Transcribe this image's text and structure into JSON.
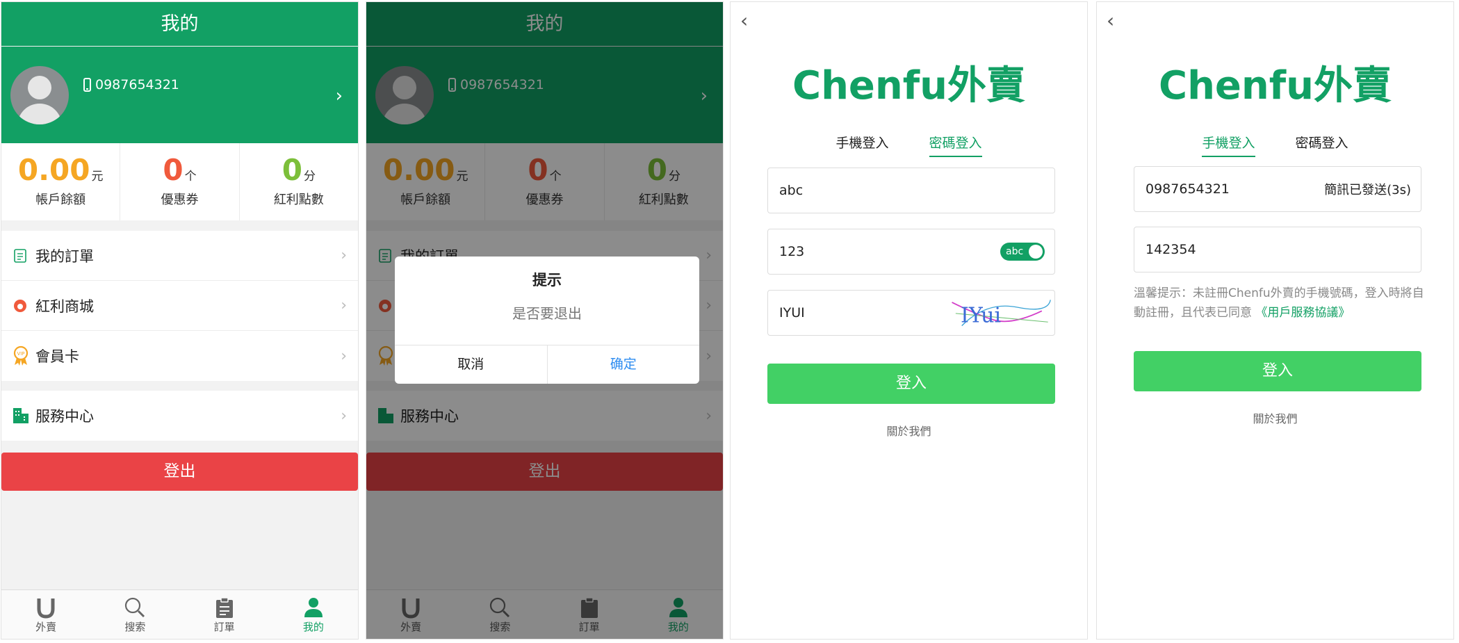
{
  "profile_screen": {
    "title": "我的",
    "phone": "0987654321",
    "stats": [
      {
        "value": "0.00",
        "unit": "元",
        "label": "帳戶餘額",
        "color": "#f5a623"
      },
      {
        "value": "0",
        "unit": "个",
        "label": "優惠券",
        "color": "#f05a3c"
      },
      {
        "value": "0",
        "unit": "分",
        "label": "紅利點數",
        "color": "#7cbf3a"
      }
    ],
    "menu": [
      {
        "label": "我的訂單",
        "icon": "order-list-icon"
      },
      {
        "label": "紅利商城",
        "icon": "bonus-mall-icon"
      },
      {
        "label": "會員卡",
        "icon": "vip-badge-icon"
      }
    ],
    "service": {
      "label": "服務中心",
      "icon": "building-icon"
    },
    "logout": "登出",
    "tabs": [
      {
        "label": "外賣",
        "icon": "takeout-icon"
      },
      {
        "label": "搜索",
        "icon": "search-icon"
      },
      {
        "label": "訂單",
        "icon": "clipboard-icon"
      },
      {
        "label": "我的",
        "icon": "user-icon",
        "active": true
      }
    ]
  },
  "dialog": {
    "title": "提示",
    "message": "是否要退出",
    "cancel": "取消",
    "confirm": "确定"
  },
  "password_login": {
    "brand": "Chenfu外賣",
    "tabs": [
      "手機登入",
      "密碼登入"
    ],
    "active_tab": "密碼登入",
    "username": "abc",
    "password": "123",
    "toggle_label": "abc",
    "captcha_input": "IYUI",
    "captcha_text": "IYui",
    "login_button": "登入",
    "about": "關於我們"
  },
  "phone_login": {
    "brand": "Chenfu外賣",
    "tabs": [
      "手機登入",
      "密碼登入"
    ],
    "active_tab": "手機登入",
    "phone": "0987654321",
    "sms_status": "簡訊已發送(3s)",
    "code": "142354",
    "tip": "溫馨提示：未註冊Chenfu外賣的手機號碼，登入時將自動註冊，且代表已同意",
    "tip_link": "《用戶服務協議》",
    "login_button": "登入",
    "about": "關於我們"
  },
  "colors": {
    "brand_green": "#12a064",
    "login_green": "#42d065",
    "logout_red": "#ea4346",
    "dialog_blue": "#2d8cf0"
  }
}
